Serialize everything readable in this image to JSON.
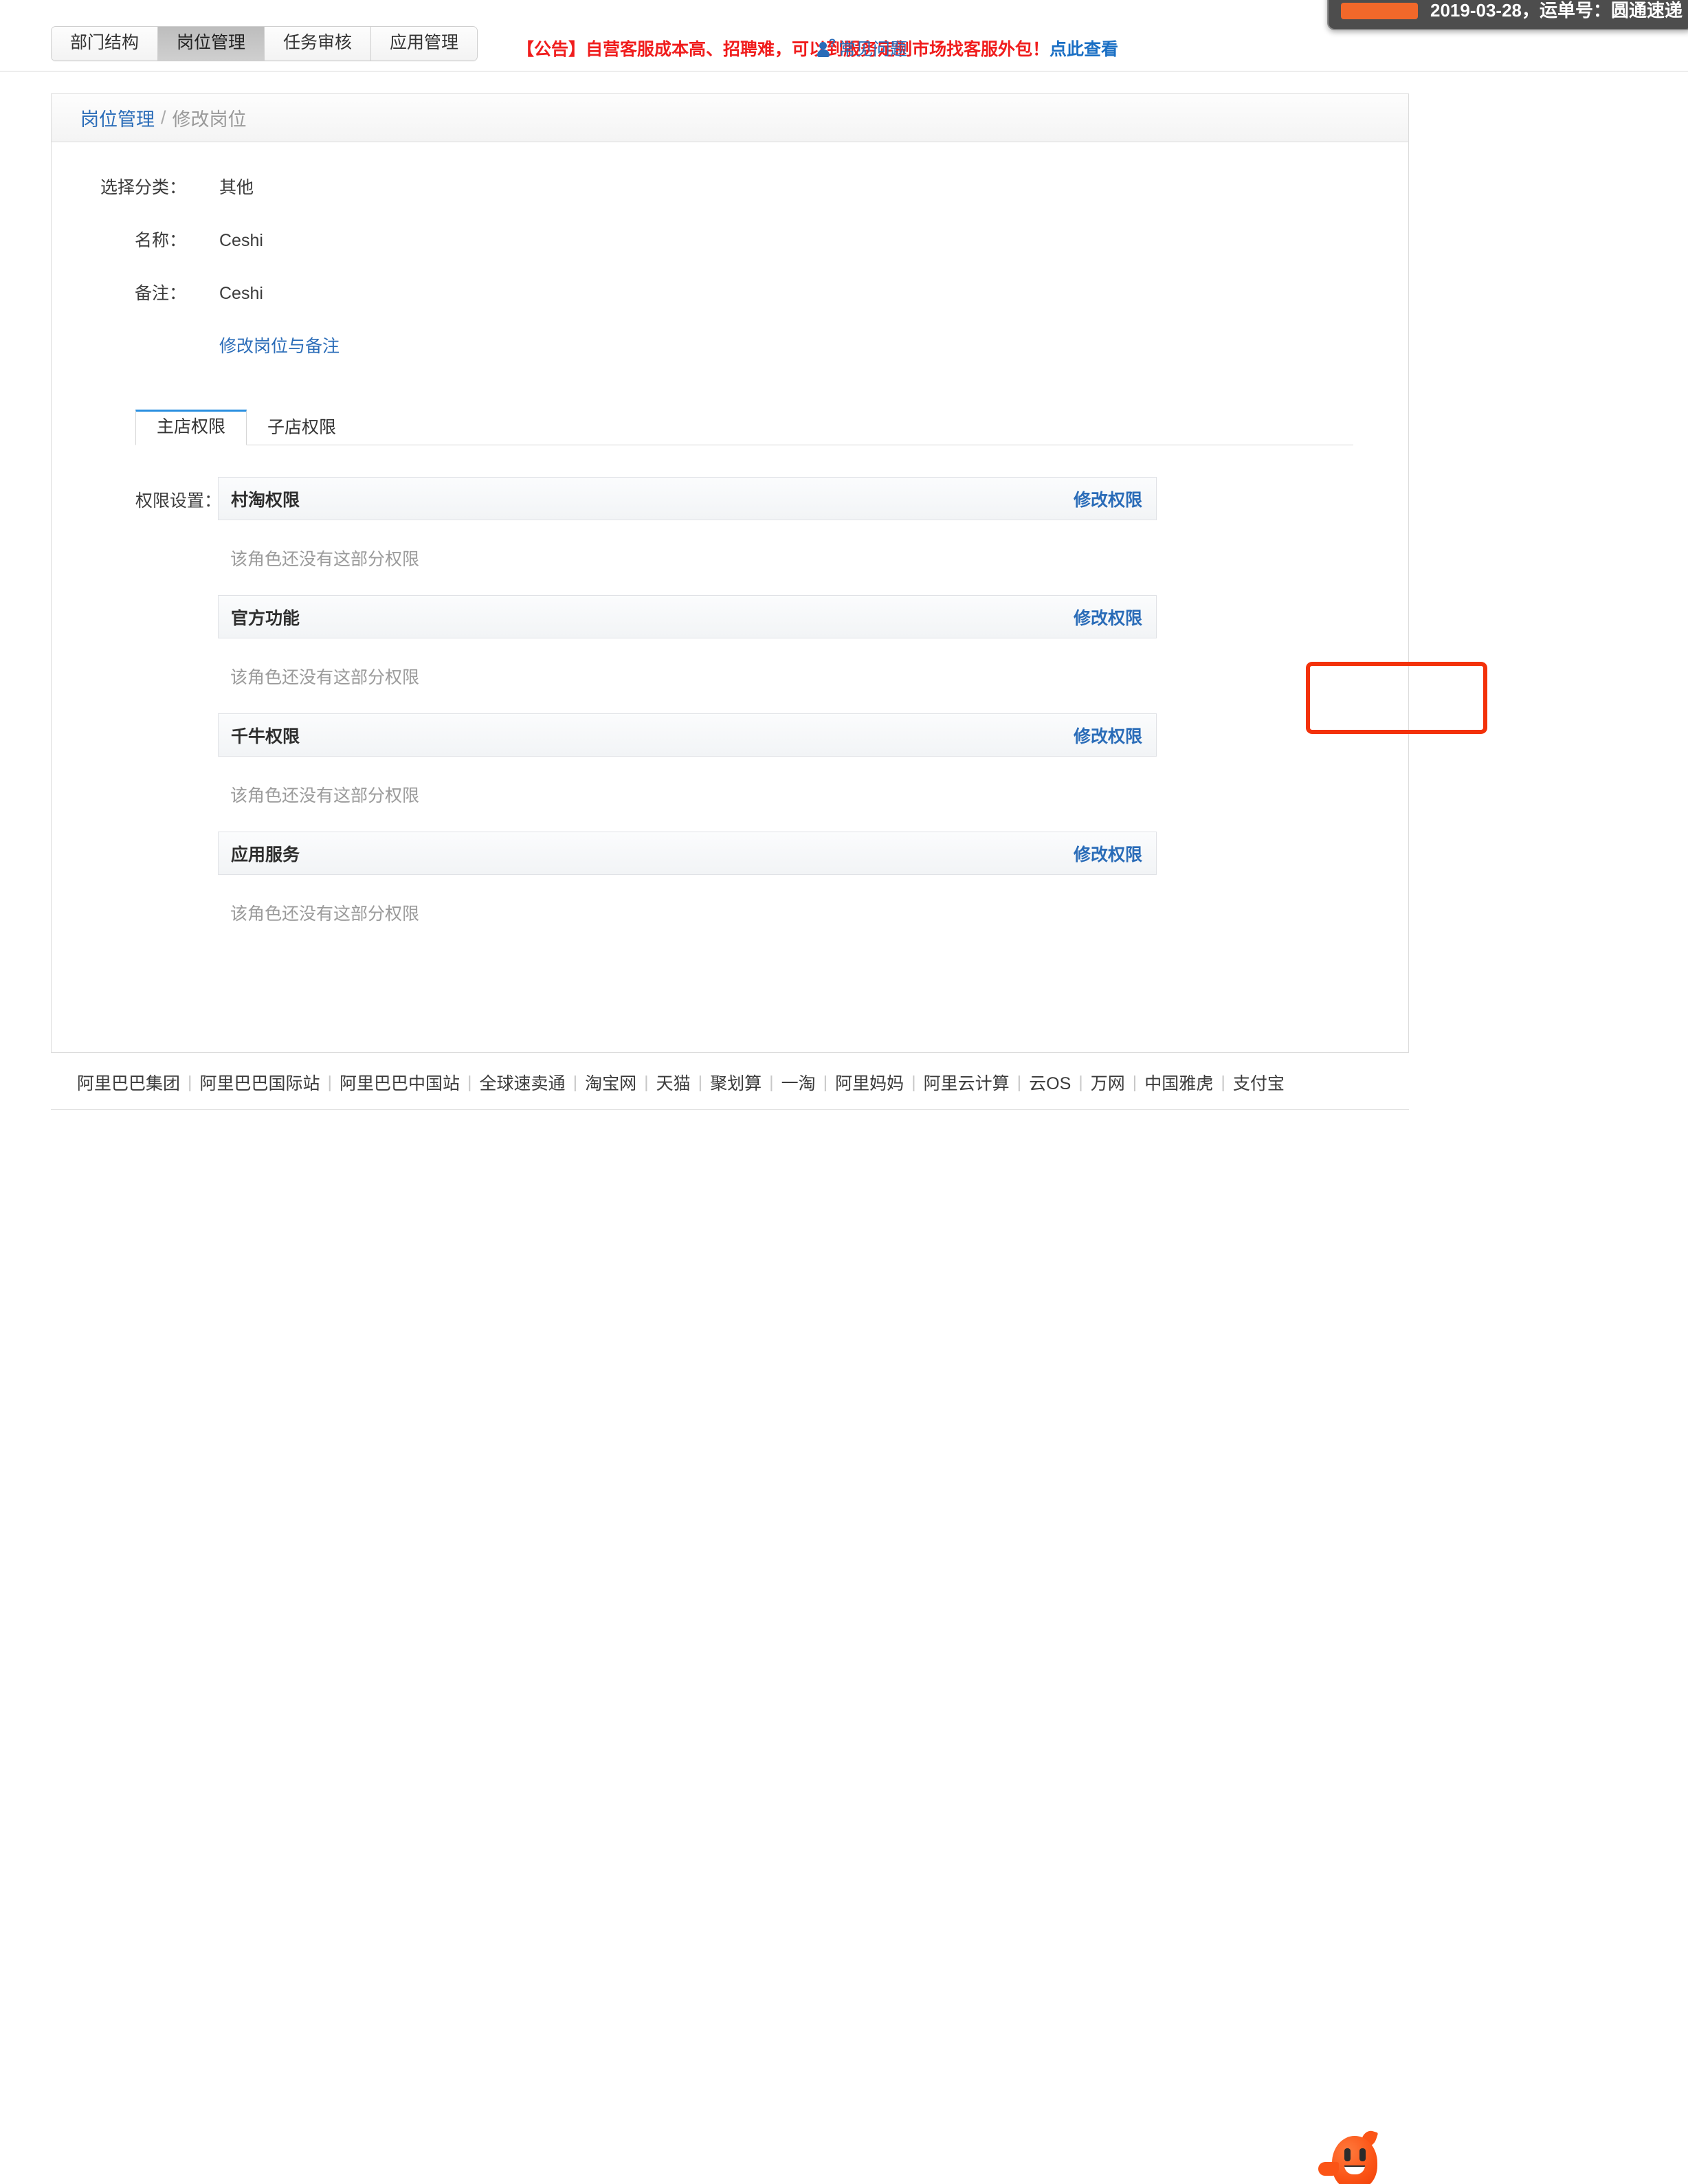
{
  "browser": {
    "url_fragment": "bao.com/subaccount/post/editPost.htm?mb2Edit=true&customPostId=62562015"
  },
  "toast": {
    "text": "2019-03-28，运单号：圆通速递"
  },
  "header": {
    "tabs": [
      {
        "label": "部门结构",
        "active": false
      },
      {
        "label": "岗位管理",
        "active": true
      },
      {
        "label": "任务审核",
        "active": false
      },
      {
        "label": "应用管理",
        "active": false
      }
    ],
    "announcement": "【公告】自营客服成本高、招聘难，可以到服务定制市场找客服外包！",
    "announcement_link": "点此查看",
    "faq_label": "常见问题",
    "faq_icon": "person-question-icon"
  },
  "breadcrumb": {
    "root": "岗位管理",
    "separator": "/",
    "current": "修改岗位"
  },
  "form": {
    "rows": [
      {
        "label": "选择分类：",
        "value": "其他"
      },
      {
        "label": "名称：",
        "value": "Ceshi"
      },
      {
        "label": "备注：",
        "value": "Ceshi"
      }
    ],
    "edit_link": "修改岗位与备注"
  },
  "subtabs": [
    {
      "label": "主店权限",
      "active": true
    },
    {
      "label": "子店权限",
      "active": false
    }
  ],
  "permissions": {
    "label": "权限设置：",
    "edit_label": "修改权限",
    "empty_text": "该角色还没有这部分权限",
    "groups": [
      {
        "title": "村淘权限"
      },
      {
        "title": "官方功能"
      },
      {
        "title": "千牛权限"
      },
      {
        "title": "应用服务"
      }
    ]
  },
  "annotation": {
    "color": "#f3310a",
    "target": "修改权限"
  },
  "footer": {
    "links": [
      "阿里巴巴集团",
      "阿里巴巴国际站",
      "阿里巴巴中国站",
      "全球速卖通",
      "淘宝网",
      "天猫",
      "聚划算",
      "一淘",
      "阿里妈妈",
      "阿里云计算",
      "云OS",
      "万网",
      "中国雅虎",
      "支付宝"
    ],
    "separator": "|",
    "mascot_icon": "taobao-mascot-icon"
  }
}
